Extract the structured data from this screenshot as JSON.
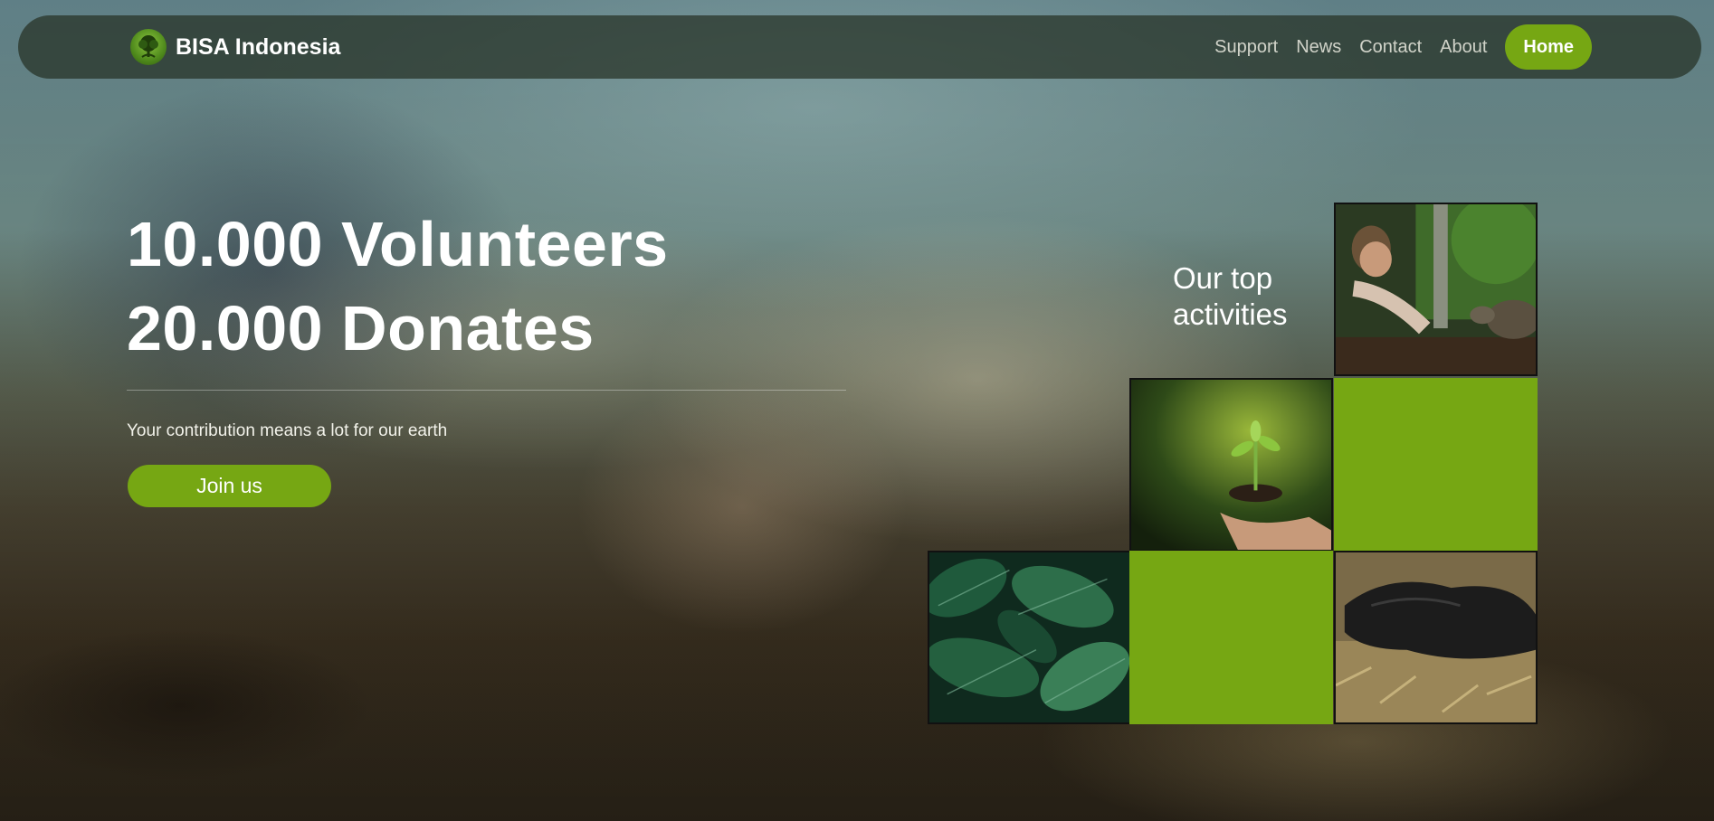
{
  "brand": {
    "name": "BISA Indonesia",
    "logo_icon": "tree-logo-icon",
    "accent_color": "#76a713"
  },
  "nav": {
    "items": [
      {
        "label": "Support"
      },
      {
        "label": "News"
      },
      {
        "label": "Contact"
      },
      {
        "label": "About"
      }
    ],
    "active_label": "Home"
  },
  "hero": {
    "line1": "10.000 Volunteers",
    "line2": "20.000 Donates",
    "tagline": "Your contribution means a lot for our earth",
    "cta_label": "Join us"
  },
  "activities": {
    "title": "Our top activities",
    "tiles": [
      {
        "kind": "photo",
        "subject": "man-feeding-tortoise"
      },
      {
        "kind": "photo",
        "subject": "hands-holding-sprout"
      },
      {
        "kind": "color",
        "color": "#76a713"
      },
      {
        "kind": "photo",
        "subject": "green-leaves"
      },
      {
        "kind": "color",
        "color": "#76a713"
      },
      {
        "kind": "photo",
        "subject": "garbage-bag-on-ground"
      }
    ]
  }
}
